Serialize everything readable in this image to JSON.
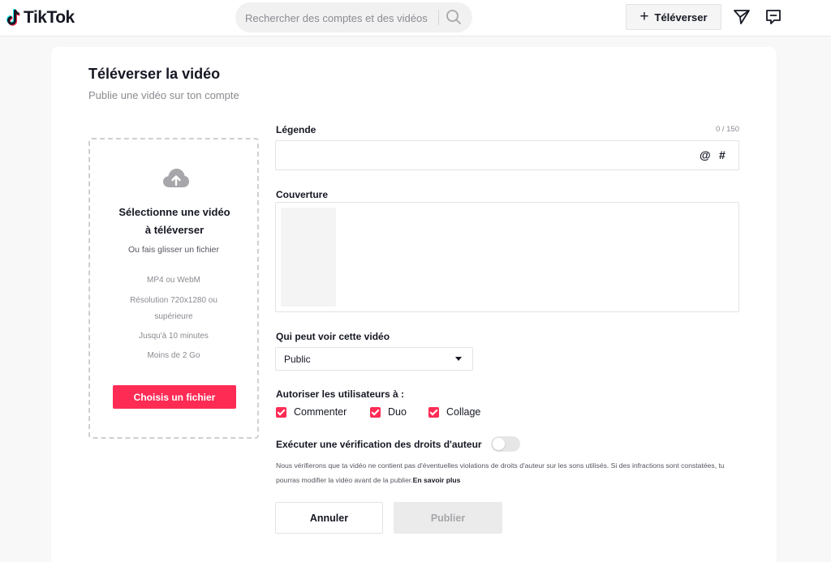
{
  "brand": {
    "name": "TikTok",
    "accent": "#fe2c55"
  },
  "header": {
    "search_placeholder": "Rechercher des comptes et des vidéos",
    "upload_label": "Téléverser",
    "upload_icon": "+"
  },
  "page": {
    "title": "Téléverser la vidéo",
    "subtitle": "Publie une vidéo sur ton compte"
  },
  "dropzone": {
    "title_line1": "Sélectionne une vidéo",
    "title_line2": "à téléverser",
    "subtitle": "Ou fais glisser un fichier",
    "specs": [
      "MP4 ou WebM",
      "Résolution 720x1280 ou",
      "supérieure",
      "Jusqu'à 10 minutes",
      "Moins de 2 Go"
    ],
    "button_label": "Choisis un fichier"
  },
  "form": {
    "caption_label": "Légende",
    "caption_counter": "0 / 150",
    "caption_value": "",
    "at_symbol": "@",
    "hash_symbol": "#",
    "cover_label": "Couverture",
    "visibility_label": "Qui peut voir cette vidéo",
    "visibility_value": "Public",
    "allow_label": "Autoriser les utilisateurs à :",
    "allow_options": [
      {
        "label": "Commenter",
        "checked": true
      },
      {
        "label": "Duo",
        "checked": true
      },
      {
        "label": "Collage",
        "checked": true
      }
    ],
    "copyright_label": "Exécuter une vérification des droits d'auteur",
    "copyright_enabled": false,
    "copyright_notice": "Nous vérifierons que ta vidéo ne contient pas d'éventuelles violations de droits d'auteur sur les sons utilisés. Si des infractions sont constatées, tu pourras modifier la vidéo avant de la publier.",
    "learn_more": "En savoir plus",
    "cancel_label": "Annuler",
    "publish_label": "Publier"
  }
}
